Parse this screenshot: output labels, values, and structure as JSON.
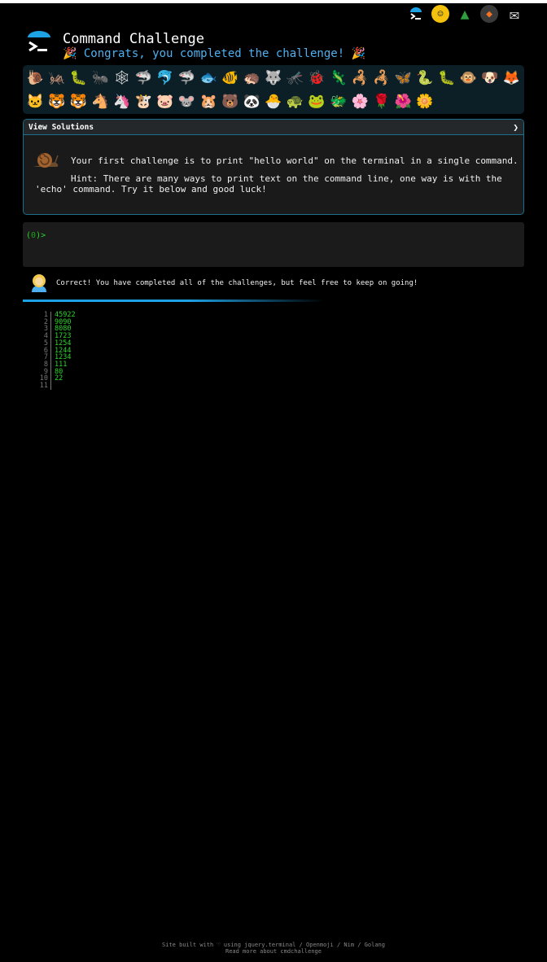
{
  "header": {
    "title": "Command Challenge",
    "subtitle": "🎉 Congrats, you completed the challenge! 🎉"
  },
  "top_icons": [
    "terminal-icon",
    "face-icon",
    "tree-icon",
    "gitlab-icon",
    "mail-icon"
  ],
  "badges": [
    "🐌",
    "🦗",
    "🐛",
    "🐜",
    "🕸",
    "🦈",
    "🐬",
    "🦈",
    "🐟",
    "🐠",
    "🦔",
    "🐺",
    "🦟",
    "🐞",
    "🦎",
    "🦂",
    "🦂",
    "🦋",
    "🐍",
    "🐛",
    "🐵",
    "🐶",
    "🦊",
    "🐱",
    "🐯",
    "🐯",
    "🐴",
    "🦄",
    "🐮",
    "🐷",
    "🐭",
    "🐹",
    "🐻",
    "🐼",
    "🐣",
    "🐢",
    "🐸",
    "🐲",
    "🌸",
    "🌹",
    "🌺",
    "🌼"
  ],
  "solutions": {
    "header": "View Solutions",
    "chevron": "❯",
    "challenge_text": "Your first challenge is to print \"hello world\" on the terminal in a single command.",
    "hint_text": "Hint: There are many ways to print text on the command line, one way is with the 'echo' command. Try it below and good luck!"
  },
  "terminal": {
    "prompt_num": "0",
    "prompt_open": "(",
    "prompt_close": ")>"
  },
  "result": {
    "text": "Correct! You have completed all of the challenges, but feel free to keep on going!"
  },
  "output_lines": [
    {
      "n": "1",
      "v": "45922"
    },
    {
      "n": "2",
      "v": "9090"
    },
    {
      "n": "3",
      "v": "8080"
    },
    {
      "n": "4",
      "v": "1723"
    },
    {
      "n": "5",
      "v": "1254"
    },
    {
      "n": "6",
      "v": "1244"
    },
    {
      "n": "7",
      "v": "1234"
    },
    {
      "n": "8",
      "v": "111"
    },
    {
      "n": "9",
      "v": "80"
    },
    {
      "n": "10",
      "v": "22"
    },
    {
      "n": "11",
      "v": ""
    }
  ],
  "footer": {
    "line1": "Site built with ♡ using jquery.terminal / Openmoji / Nim / Golang",
    "line2": "Read more about cmdchallenge"
  },
  "colors": {
    "accent": "#1ea2e6",
    "prompt_green": "#2bd62b",
    "subtitle_blue": "#4fb0f0"
  }
}
